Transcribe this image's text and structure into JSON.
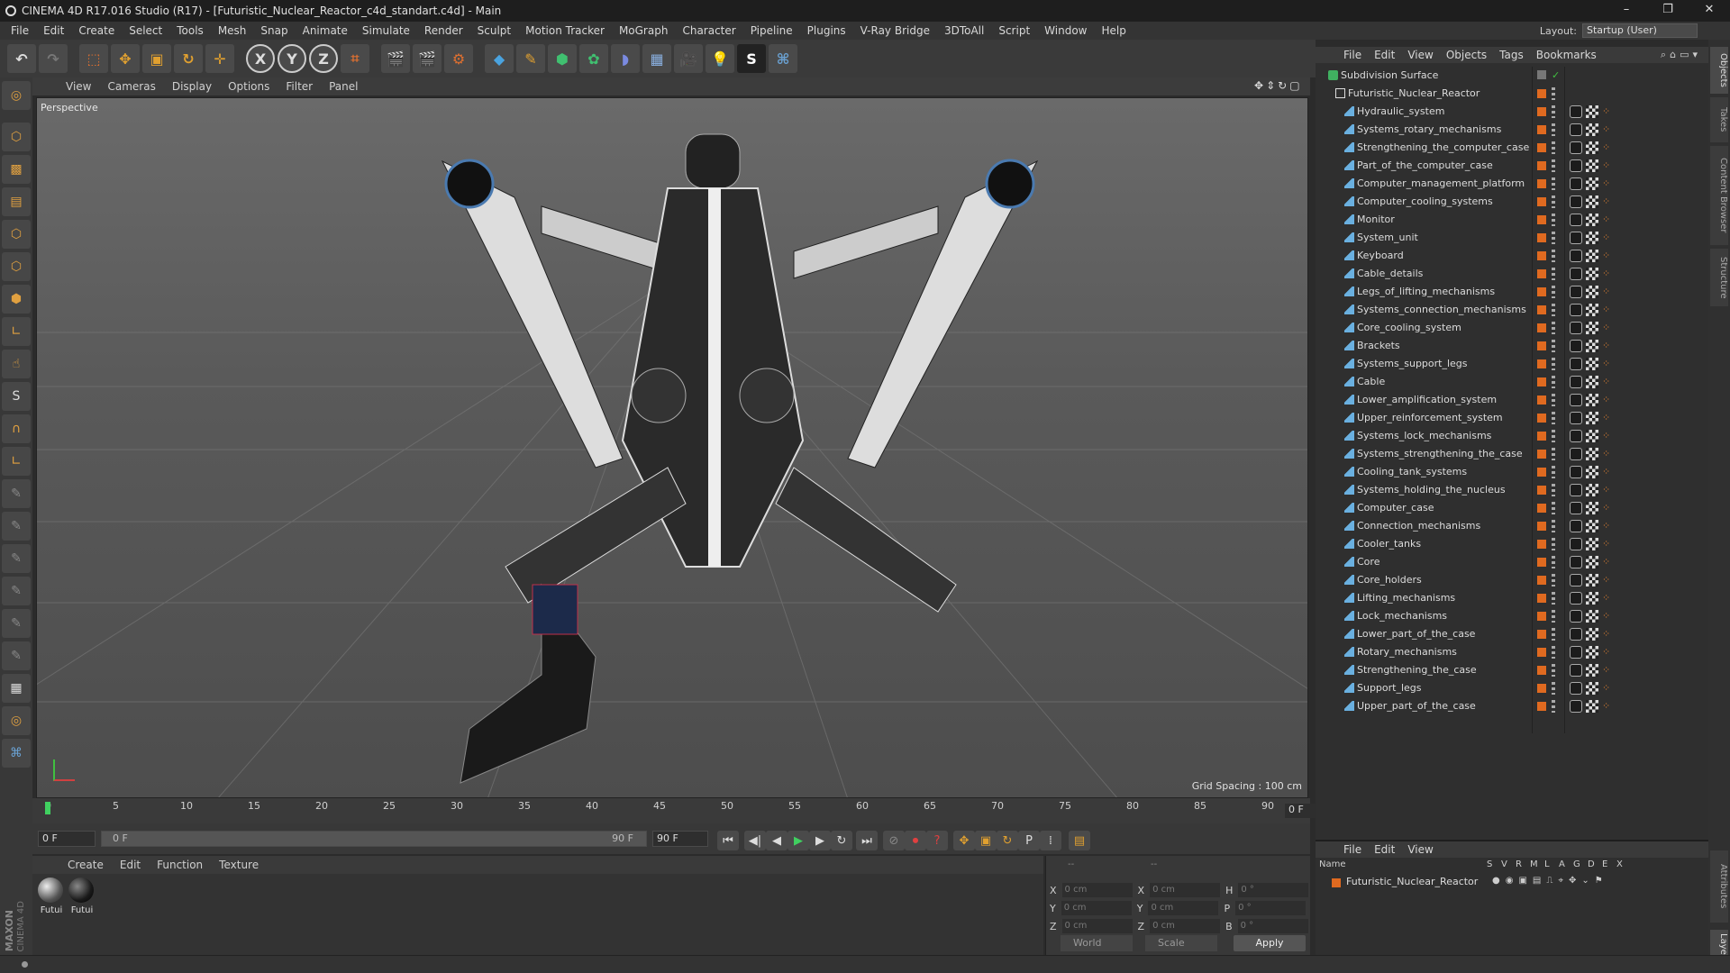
{
  "window": {
    "title": "CINEMA 4D R17.016 Studio (R17) - [Futuristic_Nuclear_Reactor_c4d_standart.c4d] - Main",
    "controls": [
      "–",
      "❐",
      "✕"
    ]
  },
  "menu": [
    "File",
    "Edit",
    "Create",
    "Select",
    "Tools",
    "Mesh",
    "Snap",
    "Animate",
    "Simulate",
    "Render",
    "Sculpt",
    "Motion Tracker",
    "MoGraph",
    "Character",
    "Pipeline",
    "Plugins",
    "V-Ray Bridge",
    "3DToAll",
    "Script",
    "Window",
    "Help"
  ],
  "layout": {
    "label": "Layout:",
    "value": "Startup (User)"
  },
  "toolbar": {
    "axis_x": "X",
    "axis_y": "Y",
    "axis_z": "Z"
  },
  "viewport": {
    "menu": [
      "View",
      "Cameras",
      "Display",
      "Options",
      "Filter",
      "Panel"
    ],
    "label": "Perspective",
    "grid_spacing": "Grid Spacing : 100 cm"
  },
  "timeline": {
    "ticks": [
      "0",
      "5",
      "10",
      "15",
      "20",
      "25",
      "30",
      "35",
      "40",
      "45",
      "50",
      "55",
      "60",
      "65",
      "70",
      "75",
      "80",
      "85",
      "90"
    ],
    "frame_indicator": "0 F"
  },
  "transport": {
    "start": "0 F",
    "slider_left": "0 F",
    "slider_right": "90 F",
    "end": "90 F"
  },
  "materials": {
    "menu": [
      "Create",
      "Edit",
      "Function",
      "Texture"
    ],
    "items": [
      {
        "label": "Futui"
      },
      {
        "label": "Futui"
      }
    ]
  },
  "coords": {
    "rows": [
      {
        "a": "X",
        "av": "0 cm",
        "b": "X",
        "bv": "0 cm",
        "c": "H",
        "cv": "0 °"
      },
      {
        "a": "Y",
        "av": "0 cm",
        "b": "Y",
        "bv": "0 cm",
        "c": "P",
        "cv": "0 °"
      },
      {
        "a": "Z",
        "av": "0 cm",
        "b": "Z",
        "bv": "0 cm",
        "c": "B",
        "cv": "0 °"
      }
    ],
    "world": "World",
    "scale": "Scale",
    "apply": "Apply",
    "header_a": "--",
    "header_b": "--"
  },
  "objects": {
    "menu": [
      "File",
      "Edit",
      "View",
      "Objects",
      "Tags",
      "Bookmarks"
    ],
    "root": "Subdivision Surface",
    "group": "Futuristic_Nuclear_Reactor",
    "children": [
      "Hydraulic_system",
      "Systems_rotary_mechanisms",
      "Strengthening_the_computer_case",
      "Part_of_the_computer_case",
      "Computer_management_platform",
      "Computer_cooling_systems",
      "Monitor",
      "System_unit",
      "Keyboard",
      "Cable_details",
      "Legs_of_lifting_mechanisms",
      "Systems_connection_mechanisms",
      "Core_cooling_system",
      "Brackets",
      "Systems_support_legs",
      "Cable",
      "Lower_amplification_system",
      "Upper_reinforcement_system",
      "Systems_lock_mechanisms",
      "Systems_strengthening_the_case",
      "Cooling_tank_systems",
      "Systems_holding_the_nucleus",
      "Computer_case",
      "Connection_mechanisms",
      "Cooler_tanks",
      "Core",
      "Core_holders",
      "Lifting_mechanisms",
      "Lock_mechanisms",
      "Lower_part_of_the_case",
      "Rotary_mechanisms",
      "Strengthening_the_case",
      "Support_legs",
      "Upper_part_of_the_case"
    ]
  },
  "layers": {
    "menu": [
      "File",
      "Edit",
      "View"
    ],
    "cols": [
      "Name",
      "S",
      "V",
      "R",
      "M",
      "L",
      "A",
      "G",
      "D",
      "E",
      "X"
    ],
    "row": "Futuristic_Nuclear_Reactor"
  },
  "right_tabs": [
    "Objects",
    "Takes",
    "Content Browser",
    "Structure",
    "Attributes",
    "Layers"
  ],
  "brand": {
    "maxon": "MAXON",
    "c4d": "CINEMA 4D"
  },
  "colors": {
    "tag": "#e06a20",
    "accent": "#4aa3df"
  }
}
